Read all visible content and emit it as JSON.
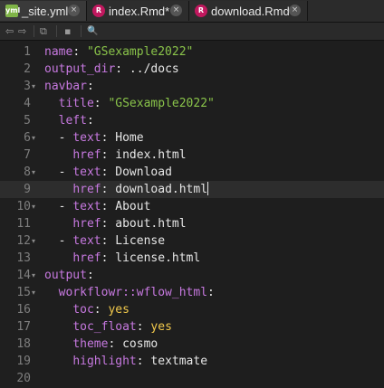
{
  "tabs": [
    {
      "label": "_site.yml",
      "icon": "yml-file-icon",
      "active": true
    },
    {
      "label": "index.Rmd*",
      "icon": "rmd-file-icon",
      "active": false
    },
    {
      "label": "download.Rmd",
      "icon": "rmd-file-icon",
      "active": false
    }
  ],
  "tab_icon_text": {
    "yml": "yml",
    "rmd": "R"
  },
  "close_glyph": "×",
  "toolbar": {
    "back": "⇦",
    "forward": "⇨",
    "show_in_window": "⧉",
    "save": "▪",
    "search": "🔍"
  },
  "editor": {
    "current_line": 9,
    "lines": [
      {
        "n": "1",
        "fold": "",
        "tokens": [
          {
            "t": "name",
            "c": "k"
          },
          {
            "t": ": ",
            "c": "p"
          },
          {
            "t": "\"GSexample2022\"",
            "c": "s"
          }
        ]
      },
      {
        "n": "2",
        "fold": "",
        "tokens": [
          {
            "t": "output_dir",
            "c": "k"
          },
          {
            "t": ": ../docs",
            "c": "p"
          }
        ]
      },
      {
        "n": "3",
        "fold": "▾",
        "tokens": [
          {
            "t": "navbar",
            "c": "k"
          },
          {
            "t": ":",
            "c": "p"
          }
        ]
      },
      {
        "n": "4",
        "fold": "",
        "tokens": [
          {
            "t": "  ",
            "c": "p"
          },
          {
            "t": "title",
            "c": "k"
          },
          {
            "t": ": ",
            "c": "p"
          },
          {
            "t": "\"GSexample2022\"",
            "c": "s"
          }
        ]
      },
      {
        "n": "5",
        "fold": "",
        "tokens": [
          {
            "t": "  ",
            "c": "p"
          },
          {
            "t": "left",
            "c": "k"
          },
          {
            "t": ":",
            "c": "p"
          }
        ]
      },
      {
        "n": "6",
        "fold": "▾",
        "tokens": [
          {
            "t": "  - ",
            "c": "p"
          },
          {
            "t": "text",
            "c": "k"
          },
          {
            "t": ": Home",
            "c": "p"
          }
        ]
      },
      {
        "n": "7",
        "fold": "",
        "tokens": [
          {
            "t": "    ",
            "c": "p"
          },
          {
            "t": "href",
            "c": "k"
          },
          {
            "t": ": index.html",
            "c": "p"
          }
        ]
      },
      {
        "n": "8",
        "fold": "▾",
        "tokens": [
          {
            "t": "  - ",
            "c": "p"
          },
          {
            "t": "text",
            "c": "k"
          },
          {
            "t": ": Download",
            "c": "p"
          }
        ]
      },
      {
        "n": "9",
        "fold": "",
        "tokens": [
          {
            "t": "    ",
            "c": "p"
          },
          {
            "t": "href",
            "c": "k"
          },
          {
            "t": ": download.html",
            "c": "p"
          }
        ],
        "cursor": true
      },
      {
        "n": "10",
        "fold": "▾",
        "tokens": [
          {
            "t": "  - ",
            "c": "p"
          },
          {
            "t": "text",
            "c": "k"
          },
          {
            "t": ": About",
            "c": "p"
          }
        ]
      },
      {
        "n": "11",
        "fold": "",
        "tokens": [
          {
            "t": "    ",
            "c": "p"
          },
          {
            "t": "href",
            "c": "k"
          },
          {
            "t": ": about.html",
            "c": "p"
          }
        ]
      },
      {
        "n": "12",
        "fold": "▾",
        "tokens": [
          {
            "t": "  - ",
            "c": "p"
          },
          {
            "t": "text",
            "c": "k"
          },
          {
            "t": ": License",
            "c": "p"
          }
        ]
      },
      {
        "n": "13",
        "fold": "",
        "tokens": [
          {
            "t": "    ",
            "c": "p"
          },
          {
            "t": "href",
            "c": "k"
          },
          {
            "t": ": license.html",
            "c": "p"
          }
        ]
      },
      {
        "n": "14",
        "fold": "▾",
        "tokens": [
          {
            "t": "output",
            "c": "k"
          },
          {
            "t": ":",
            "c": "p"
          }
        ]
      },
      {
        "n": "15",
        "fold": "▾",
        "tokens": [
          {
            "t": "  ",
            "c": "p"
          },
          {
            "t": "workflowr::wflow_html",
            "c": "k"
          },
          {
            "t": ":",
            "c": "p"
          }
        ]
      },
      {
        "n": "16",
        "fold": "",
        "tokens": [
          {
            "t": "    ",
            "c": "p"
          },
          {
            "t": "toc",
            "c": "k"
          },
          {
            "t": ": ",
            "c": "p"
          },
          {
            "t": "yes",
            "c": "b"
          }
        ]
      },
      {
        "n": "17",
        "fold": "",
        "tokens": [
          {
            "t": "    ",
            "c": "p"
          },
          {
            "t": "toc_float",
            "c": "k"
          },
          {
            "t": ": ",
            "c": "p"
          },
          {
            "t": "yes",
            "c": "b"
          }
        ]
      },
      {
        "n": "18",
        "fold": "",
        "tokens": [
          {
            "t": "    ",
            "c": "p"
          },
          {
            "t": "theme",
            "c": "k"
          },
          {
            "t": ": cosmo",
            "c": "p"
          }
        ]
      },
      {
        "n": "19",
        "fold": "",
        "tokens": [
          {
            "t": "    ",
            "c": "p"
          },
          {
            "t": "highlight",
            "c": "k"
          },
          {
            "t": ": textmate",
            "c": "p"
          }
        ]
      },
      {
        "n": "20",
        "fold": "",
        "tokens": []
      }
    ]
  }
}
